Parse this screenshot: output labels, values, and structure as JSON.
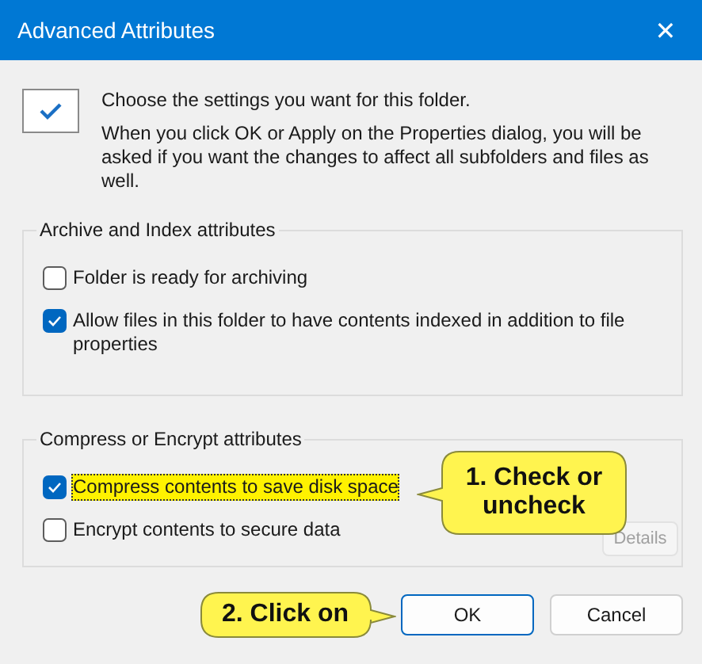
{
  "window": {
    "title": "Advanced Attributes",
    "close": "✕"
  },
  "intro": {
    "heading": "Choose the settings you want for this folder.",
    "text": "When you click OK or Apply on the Properties dialog, you will be asked if you want the changes to affect all subfolders and files as well."
  },
  "groups": [
    {
      "title": "Archive and Index attributes",
      "items": [
        {
          "label": "Folder is ready for archiving",
          "checked": false,
          "highlighted": false
        },
        {
          "label": "Allow files in this folder to have contents indexed in addition to file properties",
          "checked": true,
          "highlighted": false
        }
      ]
    },
    {
      "title": "Compress or Encrypt attributes",
      "items": [
        {
          "label": "Compress contents to save disk space",
          "checked": true,
          "highlighted": true
        },
        {
          "label": "Encrypt contents to secure data",
          "checked": false,
          "highlighted": false
        }
      ],
      "button": {
        "label": "Details",
        "disabled": true
      }
    }
  ],
  "buttons": [
    {
      "label": "OK",
      "selected": true
    },
    {
      "label": "Cancel",
      "selected": false
    }
  ],
  "callouts": [
    {
      "text": "1. Check or uncheck",
      "kind": "left"
    },
    {
      "text": "2. Click on",
      "kind": "right"
    }
  ]
}
